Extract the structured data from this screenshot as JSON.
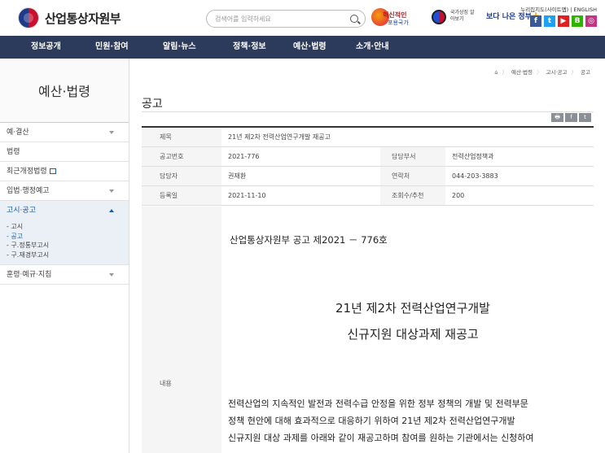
{
  "header": {
    "logo_text": "산업통상자원부",
    "search_placeholder": "검색어를 입력하세요",
    "banner1_line1": "혁신적인",
    "banner1_line2": "포용국가",
    "taegeuk_text": "국가상징 알아보기",
    "banner2": "보다 나은 정부",
    "top_links": "누리집지도(사이트맵) | ENGLISH",
    "sns": [
      {
        "label": "f",
        "color": "#3b5998"
      },
      {
        "label": "t",
        "color": "#1da1f2"
      },
      {
        "label": "▶",
        "color": "#e02020"
      },
      {
        "label": "B",
        "color": "#2db400"
      },
      {
        "label": "◎",
        "color": "#c13584"
      }
    ]
  },
  "nav": {
    "items": [
      "정보공개",
      "민원·참여",
      "알림·뉴스",
      "정책·정보",
      "예산·법령",
      "소개·안내"
    ]
  },
  "sidebar": {
    "title": "예산·법령",
    "items": {
      "budget": "예·결산",
      "law": "법령",
      "recent_law": "최근개정법령",
      "legislation": "입법·행정예고",
      "notice": "고시·공고",
      "directive": "훈령·예규·지침"
    },
    "sub_items": [
      "- 고시",
      "- 공고",
      "- 구.정통부고시",
      "- 구.재경부고시"
    ]
  },
  "breadcrumb": {
    "home": "⌂",
    "items": [
      "예산·법령",
      "고시·공고",
      "공고"
    ]
  },
  "page_title": "공고",
  "share": [
    "🖶",
    "f",
    "t"
  ],
  "info": {
    "subject_label": "제목",
    "subject": "21년 제2차 전력산업연구개발 재공고",
    "notice_no_label": "공고번호",
    "notice_no": "2021-776",
    "dept_label": "담당부서",
    "dept": "전력산업정책과",
    "person_label": "담당자",
    "person": "권재환",
    "contact_label": "연락처",
    "contact": "044-203-3883",
    "date_label": "등록일",
    "date": "2021-11-10",
    "views_label": "조회수/추천",
    "views": "200",
    "content_label": "내용"
  },
  "document": {
    "number": "산업통상자원부 공고 제2021 － 776호",
    "title_line1": "21년 제2차 전력산업연구개발",
    "title_line2": "신규지원 대상과제 재공고",
    "para": [
      "전력산업의 지속적인 발전과 전력수급 안정을 위한 정부 정책의 개발 및 전력부문",
      "정책 현안에 대해 효과적으로 대응하기 위하여 21년 제2차 전력산업연구개발",
      "신규지원 대상 과제를 아래와 같이 재공고하며 참여를 원하는 기관에서는 신청하여"
    ]
  }
}
